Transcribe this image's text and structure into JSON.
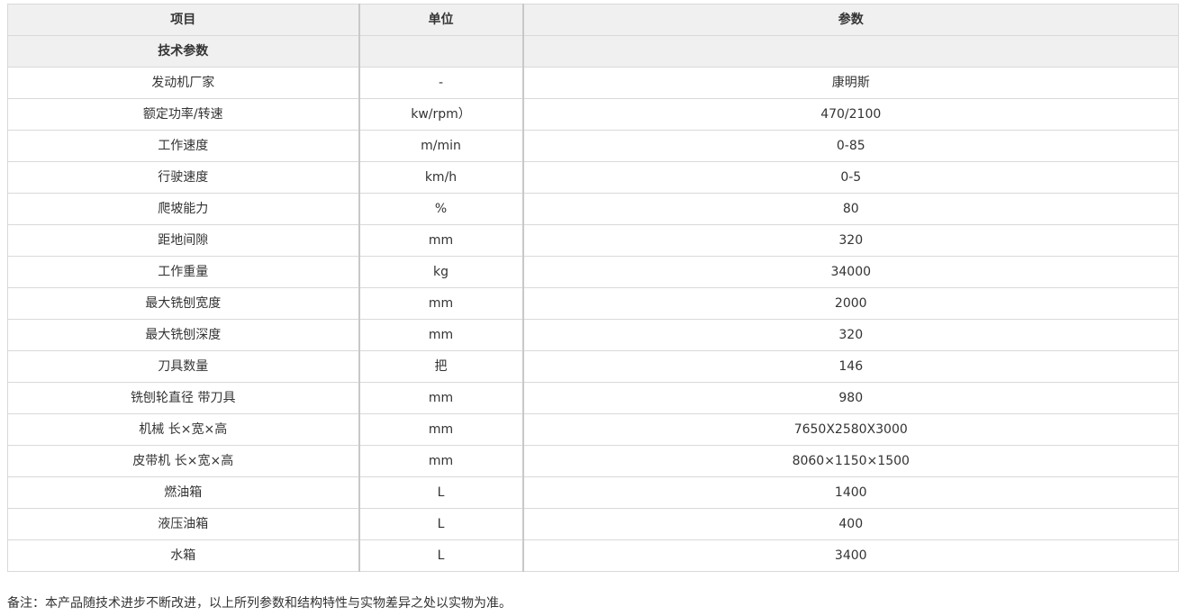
{
  "table": {
    "headers": {
      "item": "项目",
      "unit": "单位",
      "value": "参数"
    },
    "section": "技术参数",
    "rows": [
      {
        "item": "发动机厂家",
        "unit": "-",
        "value": "康明斯"
      },
      {
        "item": "额定功率/转速",
        "unit": "kw/rpm）",
        "value": "470/2100"
      },
      {
        "item": "工作速度",
        "unit": "m/min",
        "value": "0-85"
      },
      {
        "item": "行驶速度",
        "unit": "km/h",
        "value": "0-5"
      },
      {
        "item": "爬坡能力",
        "unit": "%",
        "value": "80"
      },
      {
        "item": "距地间隙",
        "unit": "mm",
        "value": "320"
      },
      {
        "item": "工作重量",
        "unit": "kg",
        "value": "34000"
      },
      {
        "item": "最大铣刨宽度",
        "unit": "mm",
        "value": "2000"
      },
      {
        "item": "最大铣刨深度",
        "unit": "mm",
        "value": "320"
      },
      {
        "item": "刀具数量",
        "unit": "把",
        "value": "146"
      },
      {
        "item": "铣刨轮直径 带刀具",
        "unit": "mm",
        "value": "980"
      },
      {
        "item": "机械 长×宽×高",
        "unit": "mm",
        "value": "7650X2580X3000"
      },
      {
        "item": "皮带机 长×宽×高",
        "unit": "mm",
        "value": "8060×1150×1500"
      },
      {
        "item": "燃油箱",
        "unit": "L",
        "value": "1400"
      },
      {
        "item": "液压油箱",
        "unit": "L",
        "value": "400"
      },
      {
        "item": "水箱",
        "unit": "L",
        "value": "3400"
      }
    ]
  },
  "note": "备注：本产品随技术进步不断改进，以上所列参数和结构特性与实物差异之处以实物为准。"
}
